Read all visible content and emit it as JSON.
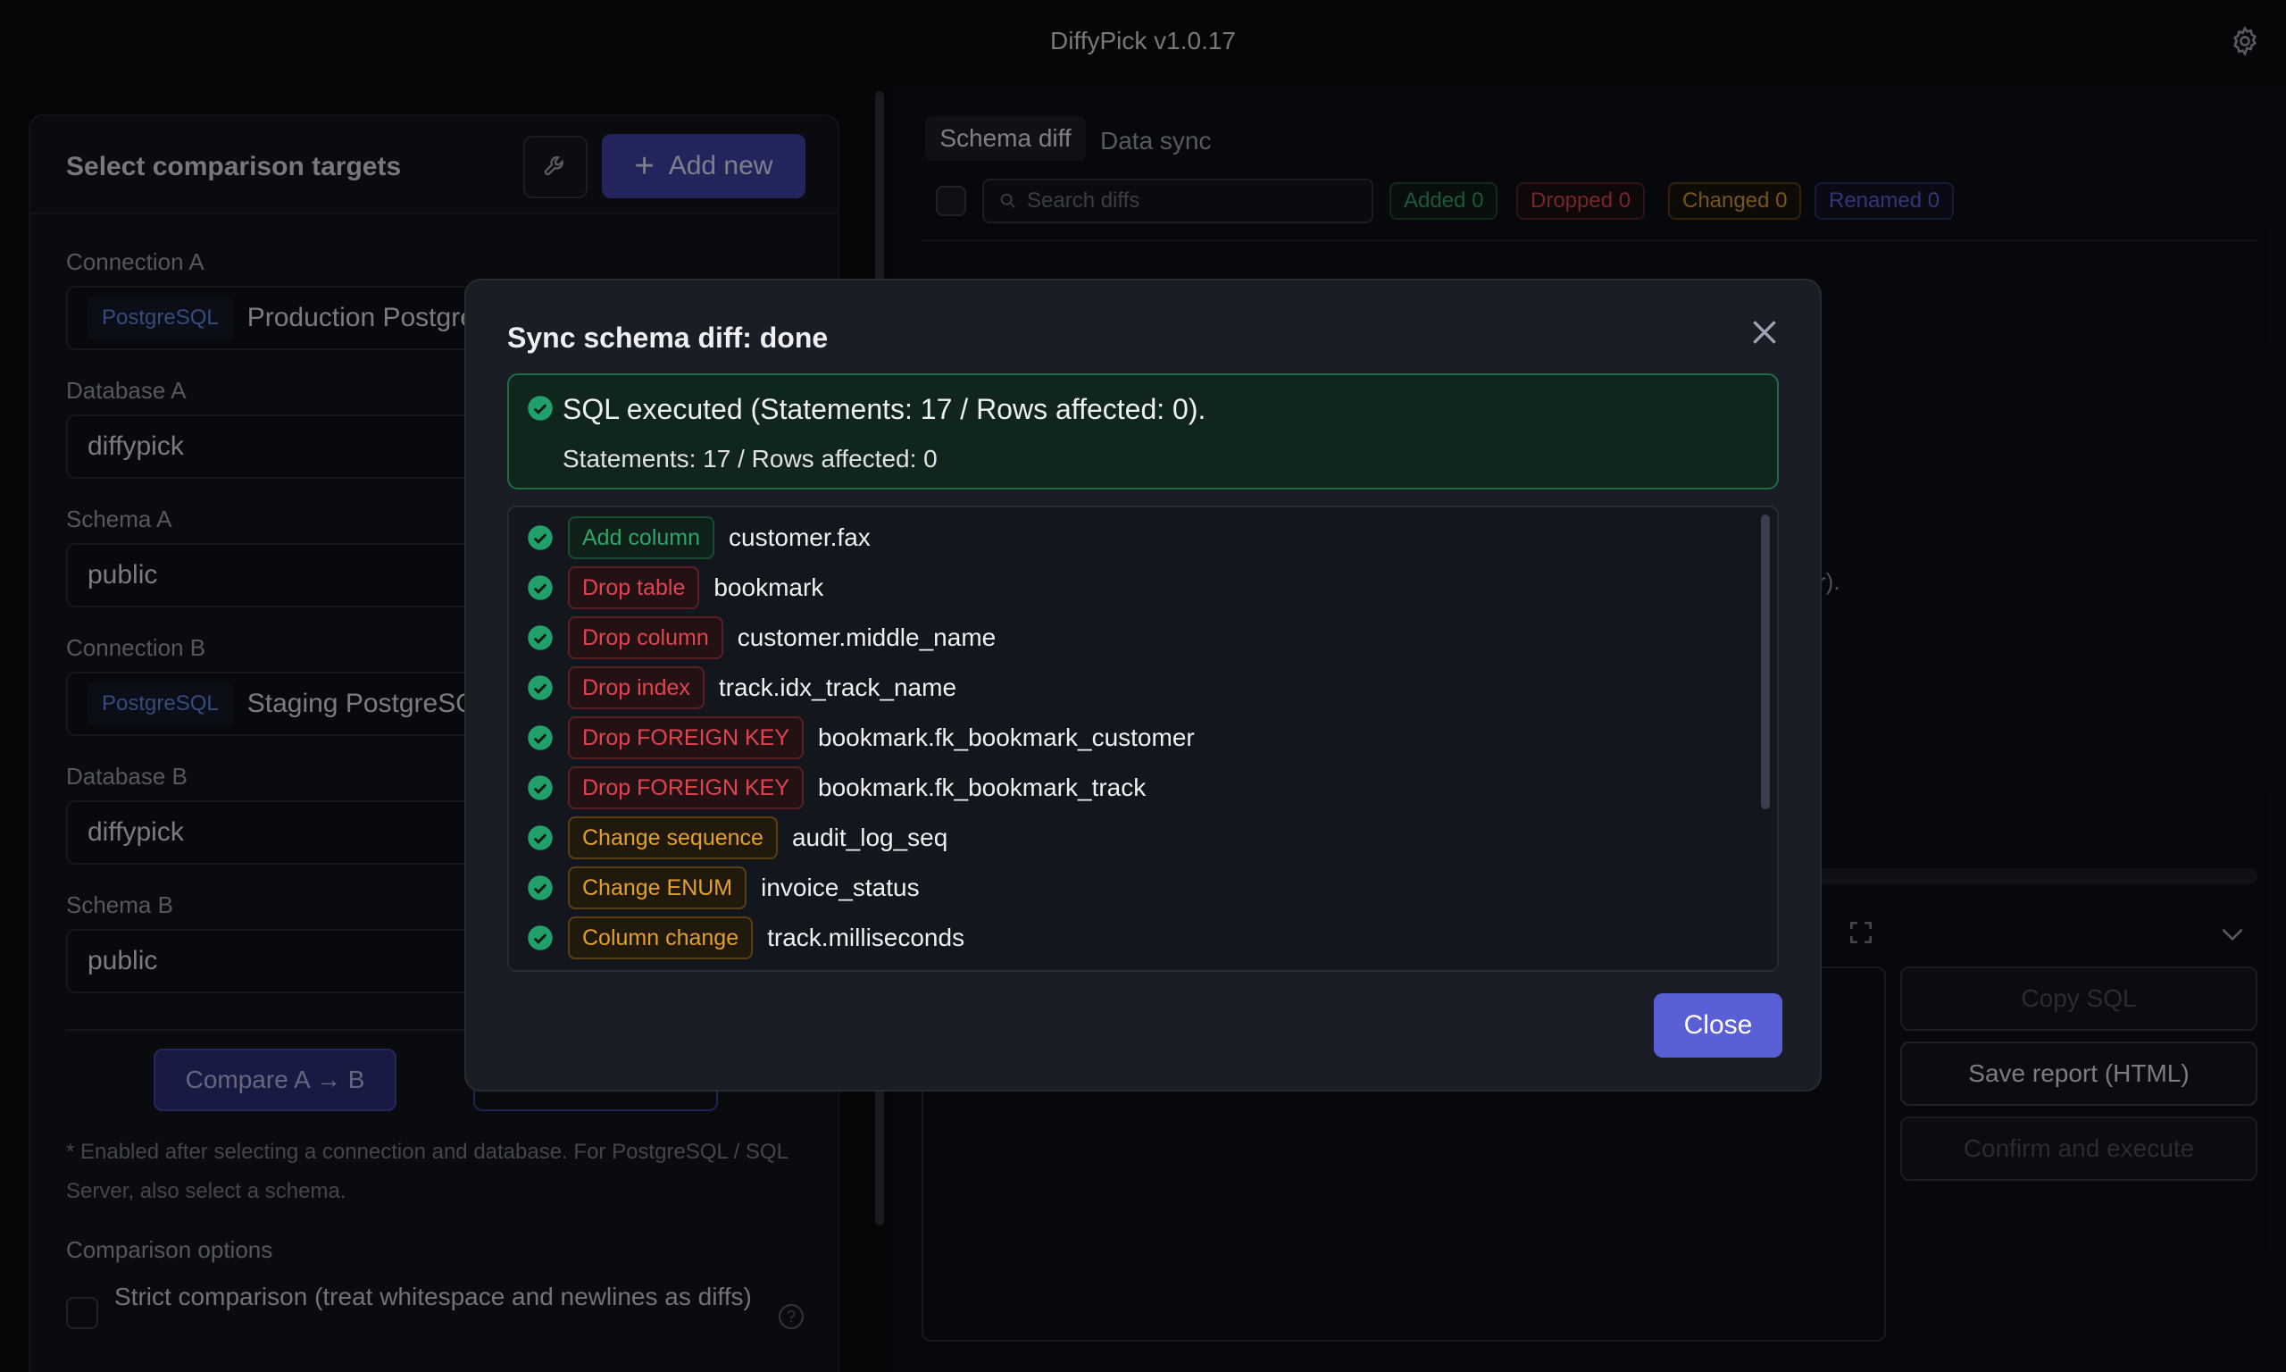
{
  "app": {
    "title": "DiffyPick v1.0.17"
  },
  "left": {
    "title": "Select comparison targets",
    "add_new": "Add new",
    "connection_a_label": "Connection A",
    "connection_a_type": "PostgreSQL",
    "connection_a_value": "Production Postgre",
    "database_a_label": "Database A",
    "database_a_value": "diffypick",
    "schema_a_label": "Schema A",
    "schema_a_value": "public",
    "connection_b_label": "Connection B",
    "connection_b_type": "PostgreSQL",
    "connection_b_value": "Staging PostgreSQ",
    "database_b_label": "Database B",
    "database_b_value": "diffypick",
    "schema_b_label": "Schema B",
    "schema_b_value": "public",
    "compare_button": "Compare A → B",
    "hint": "* Enabled after selecting a connection and database. For PostgreSQL / SQL Server, also select a schema.",
    "options_label": "Comparison options",
    "strict_label": "Strict comparison (treat whitespace and newlines as diffs)"
  },
  "right": {
    "tabs": [
      {
        "label": "Schema diff",
        "active": true
      },
      {
        "label": "Data sync",
        "active": false
      }
    ],
    "search_placeholder": "Search diffs",
    "badges": {
      "added": "Added 0",
      "dropped": "Dropped 0",
      "changed": "Changed 0",
      "renamed": "Renamed 0"
    },
    "bg_text": "r).",
    "actions": {
      "copy": "Copy SQL",
      "save": "Save report (HTML)",
      "confirm": "Confirm and execute"
    }
  },
  "modal": {
    "title": "Sync schema diff: done",
    "success_title": "SQL executed (Statements: 17 / Rows affected: 0).",
    "success_sub": "Statements: 17 / Rows affected: 0",
    "items": [
      {
        "tag": "Add column",
        "kind": "add",
        "text": "customer.fax"
      },
      {
        "tag": "Drop table",
        "kind": "drop",
        "text": "bookmark"
      },
      {
        "tag": "Drop column",
        "kind": "drop",
        "text": "customer.middle_name"
      },
      {
        "tag": "Drop index",
        "kind": "drop",
        "text": "track.idx_track_name"
      },
      {
        "tag": "Drop FOREIGN KEY",
        "kind": "drop",
        "text": "bookmark.fk_bookmark_customer"
      },
      {
        "tag": "Drop FOREIGN KEY",
        "kind": "drop",
        "text": "bookmark.fk_bookmark_track"
      },
      {
        "tag": "Change sequence",
        "kind": "change",
        "text": "audit_log_seq"
      },
      {
        "tag": "Change ENUM",
        "kind": "change",
        "text": "invoice_status"
      },
      {
        "tag": "Column change",
        "kind": "change",
        "text": "track.milliseconds"
      }
    ],
    "close_button": "Close"
  },
  "colors": {
    "accent": "#5a5fd6",
    "success": "#22a06b",
    "danger": "#e0454f",
    "warning": "#e0a030"
  },
  "icons": [
    "gear-icon",
    "wrench-icon",
    "plus-icon",
    "search-icon",
    "expand-icon",
    "chevron-down-icon",
    "close-icon",
    "check-circle-icon",
    "help-icon"
  ]
}
